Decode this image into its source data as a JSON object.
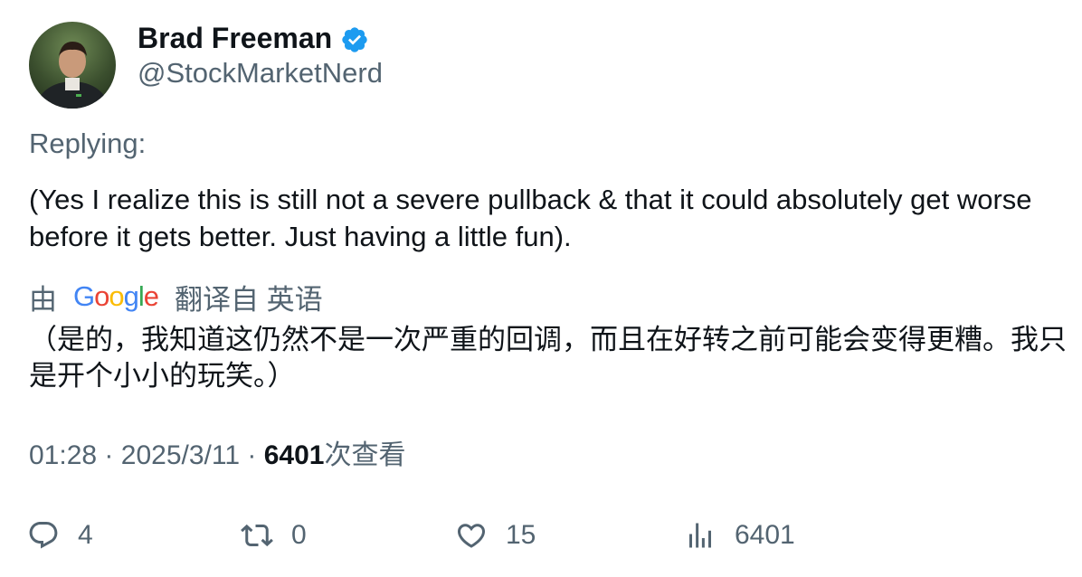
{
  "author": {
    "name": "Brad Freeman",
    "handle": "@StockMarketNerd",
    "verified": true
  },
  "replying_label": "Replying:",
  "tweet_text": "(Yes I realize this is still not a severe pullback & that it could absolutely get worse before it gets better. Just having a little fun).",
  "translation": {
    "prefix": "由",
    "provider": "Google",
    "suffix": "翻译自 英语",
    "text": "（是的，我知道这仍然不是一次严重的回调，而且在好转之前可能会变得更糟。我只是开个小小的玩笑。）"
  },
  "meta": {
    "time": "01:28",
    "separator": "·",
    "date": "2025/3/11",
    "views_count": "6401",
    "views_label": "次查看"
  },
  "actions": {
    "replies": "4",
    "retweets": "0",
    "likes": "15",
    "views": "6401"
  },
  "colors": {
    "text": "#0f1419",
    "secondary": "#536471",
    "verified": "#1d9bf0"
  },
  "icons": [
    "verified-badge-icon",
    "reply-icon",
    "retweet-icon",
    "like-icon",
    "views-icon"
  ]
}
